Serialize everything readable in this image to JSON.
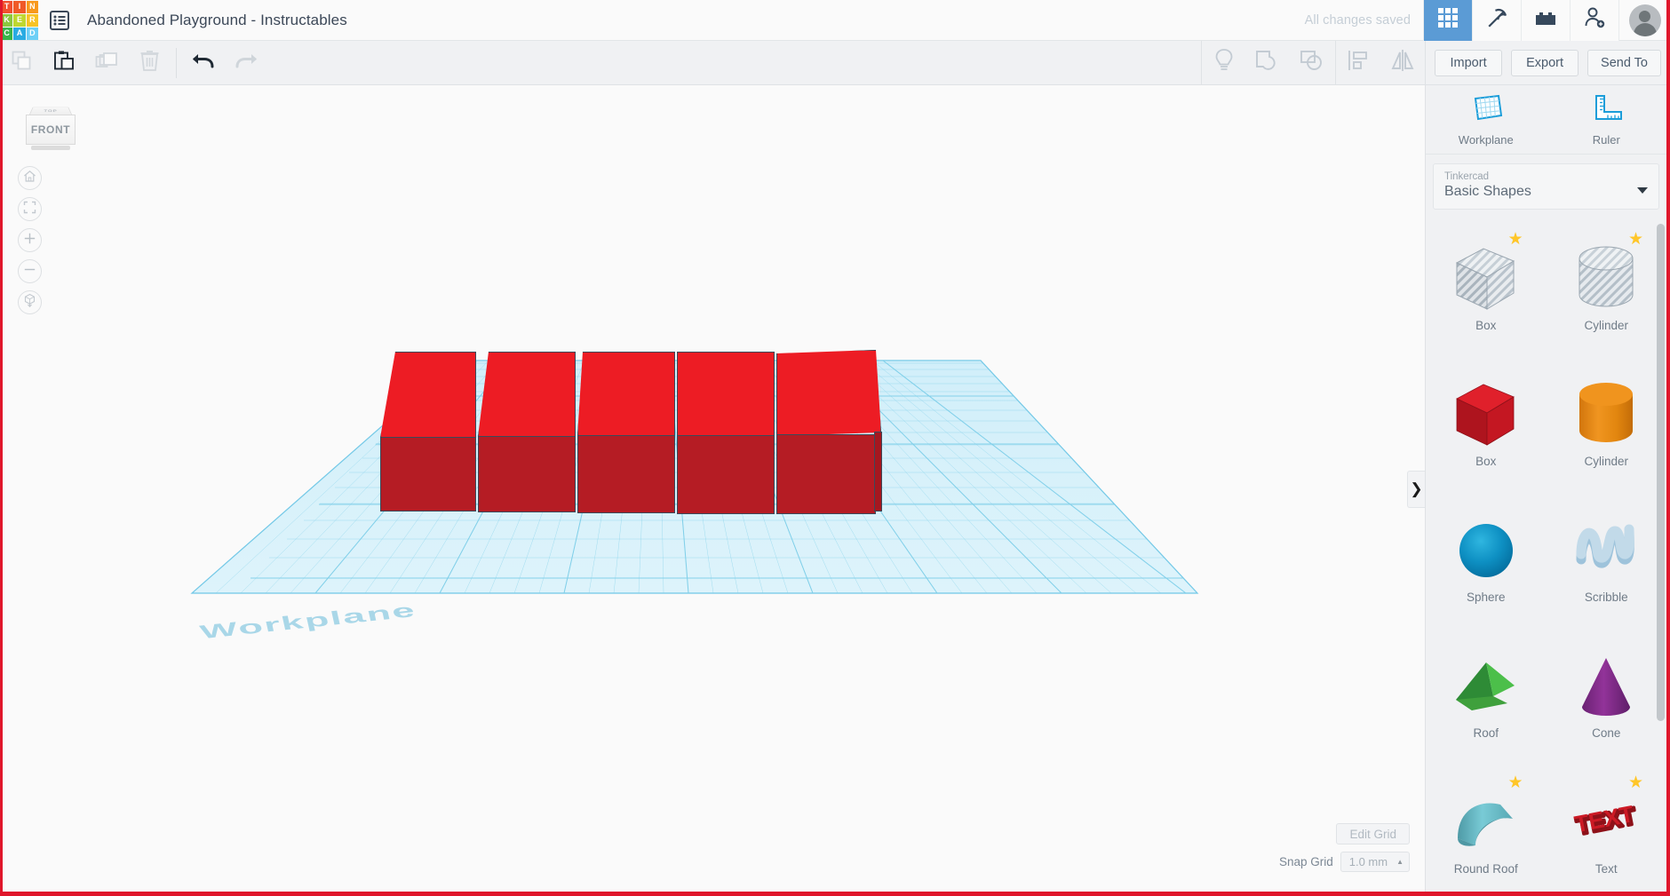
{
  "app": {
    "logo_letters": [
      "T",
      "I",
      "N",
      "K",
      "E",
      "R",
      "C",
      "A",
      "D"
    ],
    "logo_colors": [
      "#F1502F",
      "#F05A28",
      "#F8991D",
      "#8CC63F",
      "#BFD730",
      "#F7C325",
      "#39B54A",
      "#29ABE2",
      "#6DCFF6"
    ],
    "document_title": "Abandoned Playground - Instructables",
    "save_status": "All changes saved",
    "top_icons": [
      {
        "name": "grid-view-icon",
        "label": "Gallery",
        "active": true
      },
      {
        "name": "pickaxe-icon",
        "label": "Blocks",
        "active": false
      },
      {
        "name": "lego-brick-icon",
        "label": "Bricks",
        "active": false
      },
      {
        "name": "add-user-icon",
        "label": "Invite",
        "active": false
      }
    ],
    "avatar_label": "Account"
  },
  "toolbar": {
    "left_tools": [
      {
        "name": "copy-icon",
        "label": "Copy",
        "enabled": false
      },
      {
        "name": "paste-icon",
        "label": "Paste",
        "enabled": true
      },
      {
        "name": "duplicate-icon",
        "label": "Duplicate",
        "enabled": false
      },
      {
        "name": "delete-icon",
        "label": "Delete",
        "enabled": false
      }
    ],
    "history_tools": [
      {
        "name": "undo-icon",
        "label": "Undo",
        "enabled": true
      },
      {
        "name": "redo-icon",
        "label": "Redo",
        "enabled": false
      }
    ],
    "right_tools": [
      {
        "name": "lightbulb-icon",
        "label": "Hide / Show"
      },
      {
        "name": "group-icon",
        "label": "Group"
      },
      {
        "name": "ungroup-icon",
        "label": "Ungroup"
      },
      {
        "name": "align-icon",
        "label": "Align"
      },
      {
        "name": "mirror-icon",
        "label": "Mirror"
      }
    ],
    "buttons": [
      {
        "name": "import-button",
        "label": "Import"
      },
      {
        "name": "export-button",
        "label": "Export"
      },
      {
        "name": "send-to-button",
        "label": "Send To"
      }
    ]
  },
  "viewport": {
    "viewcube": {
      "top_label": "TOP",
      "front_label": "FRONT"
    },
    "nav_buttons": [
      {
        "name": "home-view-button",
        "label": "Home view",
        "icon": "home-icon"
      },
      {
        "name": "fit-view-button",
        "label": "Fit all in view",
        "icon": "fit-frame-icon"
      },
      {
        "name": "zoom-in-button",
        "label": "Zoom in",
        "icon": "plus-icon"
      },
      {
        "name": "zoom-out-button",
        "label": "Zoom out",
        "icon": "minus-icon"
      },
      {
        "name": "ortho-toggle-button",
        "label": "Switch to orthographic view",
        "icon": "cube-arrow-icon"
      }
    ],
    "workplane_label": "Workplane",
    "shape_count": 5,
    "shape_color_top": "#ED1C24",
    "shape_color_front": "#B51C24",
    "grid_color": "#8ED8F0",
    "edit_grid_label": "Edit Grid",
    "snap_grid_label": "Snap Grid",
    "snap_grid_value": "1.0 mm"
  },
  "right_panel": {
    "tools": [
      {
        "name": "workplane-tool",
        "label": "Workplane",
        "icon": "workplane-icon"
      },
      {
        "name": "ruler-tool",
        "label": "Ruler",
        "icon": "ruler-icon"
      }
    ],
    "library_source": "Tinkercad",
    "library_name": "Basic Shapes",
    "shapes": [
      {
        "name": "shape-box-hole",
        "label": "Box",
        "icon": "box-hole-icon",
        "starred": true
      },
      {
        "name": "shape-cylinder-hole",
        "label": "Cylinder",
        "icon": "cylinder-hole-icon",
        "starred": true
      },
      {
        "name": "shape-box",
        "label": "Box",
        "icon": "box-icon",
        "starred": false
      },
      {
        "name": "shape-cylinder",
        "label": "Cylinder",
        "icon": "cylinder-icon",
        "starred": false
      },
      {
        "name": "shape-sphere",
        "label": "Sphere",
        "icon": "sphere-icon",
        "starred": false
      },
      {
        "name": "shape-scribble",
        "label": "Scribble",
        "icon": "scribble-icon",
        "starred": false
      },
      {
        "name": "shape-roof",
        "label": "Roof",
        "icon": "roof-icon",
        "starred": false
      },
      {
        "name": "shape-cone",
        "label": "Cone",
        "icon": "cone-icon",
        "starred": false
      },
      {
        "name": "shape-round-roof",
        "label": "Round Roof",
        "icon": "round-roof-icon",
        "starred": true
      },
      {
        "name": "shape-text",
        "label": "Text",
        "icon": "text-shape-icon",
        "starred": true
      }
    ],
    "collapse_label": "❯"
  }
}
